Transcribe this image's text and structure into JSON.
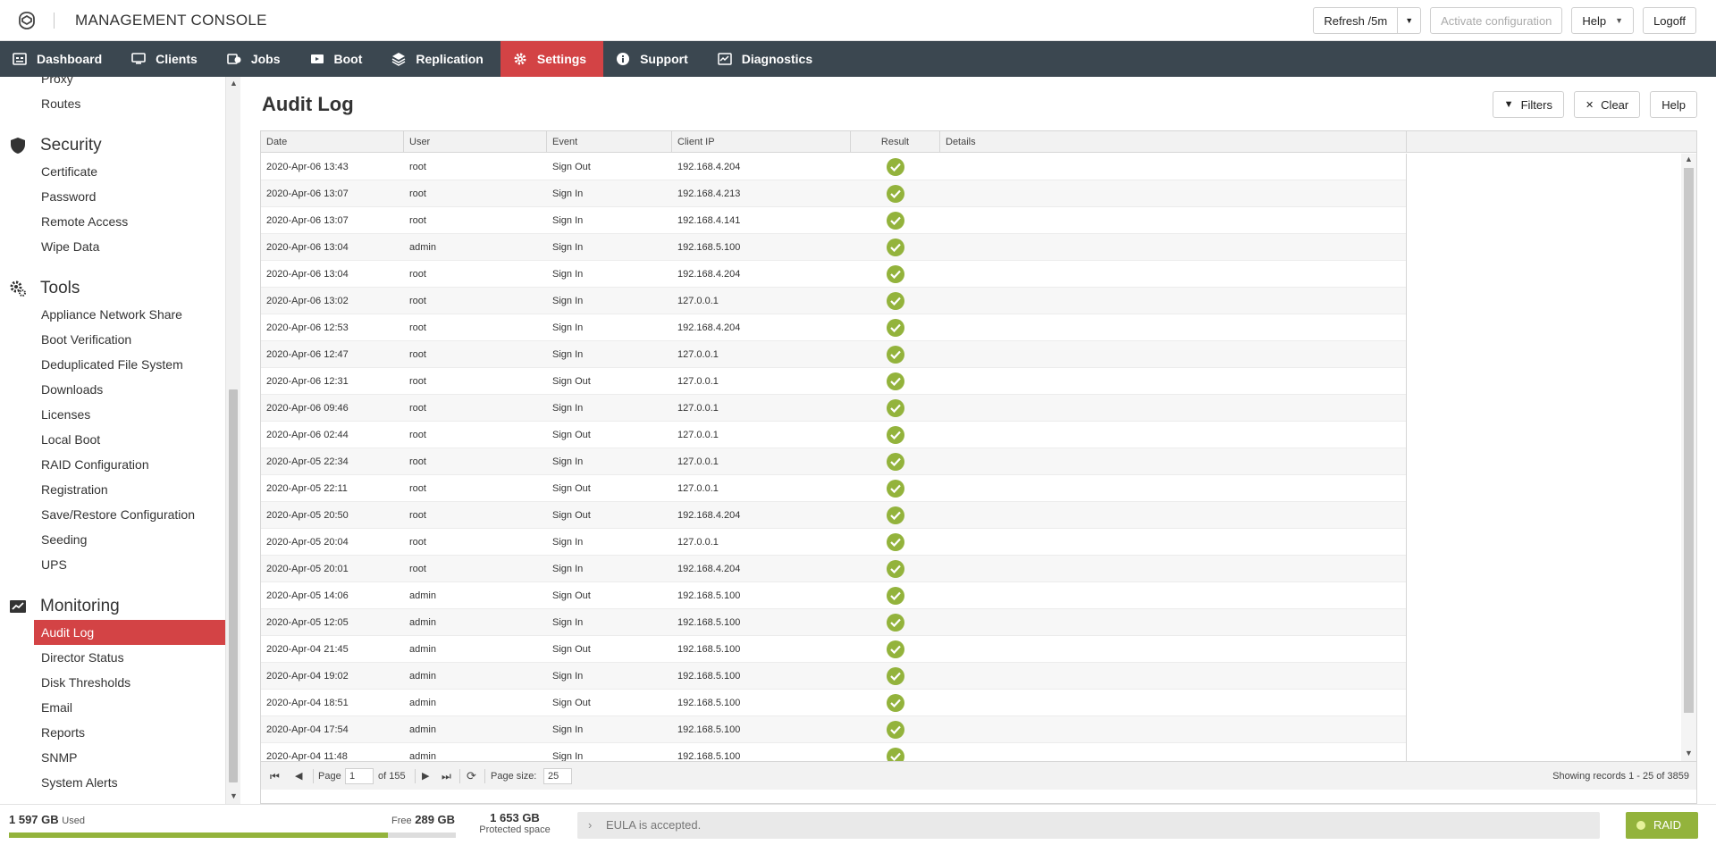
{
  "header": {
    "title": "MANAGEMENT CONSOLE",
    "refresh_label": "Refresh /5m",
    "activate_label": "Activate configuration",
    "help_label": "Help",
    "logoff_label": "Logoff"
  },
  "nav": [
    {
      "label": "Dashboard",
      "icon": "dashboard-icon"
    },
    {
      "label": "Clients",
      "icon": "monitor-icon"
    },
    {
      "label": "Jobs",
      "icon": "jobs-icon"
    },
    {
      "label": "Boot",
      "icon": "boot-icon"
    },
    {
      "label": "Replication",
      "icon": "replication-icon"
    },
    {
      "label": "Settings",
      "icon": "gear-icon",
      "active": true
    },
    {
      "label": "Support",
      "icon": "info-icon"
    },
    {
      "label": "Diagnostics",
      "icon": "diagnostics-icon"
    }
  ],
  "sidebar": {
    "network_tail": [
      "Proxy",
      "Routes"
    ],
    "security": {
      "title": "Security",
      "items": [
        "Certificate",
        "Password",
        "Remote Access",
        "Wipe Data"
      ]
    },
    "tools": {
      "title": "Tools",
      "items": [
        "Appliance Network Share",
        "Boot Verification",
        "Deduplicated File System",
        "Downloads",
        "Licenses",
        "Local Boot",
        "RAID Configuration",
        "Registration",
        "Save/Restore Configuration",
        "Seeding",
        "UPS"
      ]
    },
    "monitoring": {
      "title": "Monitoring",
      "items": [
        "Audit Log",
        "Director Status",
        "Disk Thresholds",
        "Email",
        "Reports",
        "SNMP",
        "System Alerts"
      ],
      "active": "Audit Log"
    }
  },
  "main": {
    "title": "Audit Log",
    "filters_label": "Filters",
    "clear_label": "Clear",
    "help_label": "Help"
  },
  "grid": {
    "columns": [
      "Date",
      "User",
      "Event",
      "Client IP",
      "Result",
      "Details"
    ],
    "rows": [
      [
        "2020-Apr-06 13:43",
        "root",
        "Sign Out",
        "192.168.4.204"
      ],
      [
        "2020-Apr-06 13:07",
        "root",
        "Sign In",
        "192.168.4.213"
      ],
      [
        "2020-Apr-06 13:07",
        "root",
        "Sign In",
        "192.168.4.141"
      ],
      [
        "2020-Apr-06 13:04",
        "admin",
        "Sign In",
        "192.168.5.100"
      ],
      [
        "2020-Apr-06 13:04",
        "root",
        "Sign In",
        "192.168.4.204"
      ],
      [
        "2020-Apr-06 13:02",
        "root",
        "Sign In",
        "127.0.0.1"
      ],
      [
        "2020-Apr-06 12:53",
        "root",
        "Sign In",
        "192.168.4.204"
      ],
      [
        "2020-Apr-06 12:47",
        "root",
        "Sign In",
        "127.0.0.1"
      ],
      [
        "2020-Apr-06 12:31",
        "root",
        "Sign Out",
        "127.0.0.1"
      ],
      [
        "2020-Apr-06 09:46",
        "root",
        "Sign In",
        "127.0.0.1"
      ],
      [
        "2020-Apr-06 02:44",
        "root",
        "Sign Out",
        "127.0.0.1"
      ],
      [
        "2020-Apr-05 22:34",
        "root",
        "Sign In",
        "127.0.0.1"
      ],
      [
        "2020-Apr-05 22:11",
        "root",
        "Sign Out",
        "127.0.0.1"
      ],
      [
        "2020-Apr-05 20:50",
        "root",
        "Sign Out",
        "192.168.4.204"
      ],
      [
        "2020-Apr-05 20:04",
        "root",
        "Sign In",
        "127.0.0.1"
      ],
      [
        "2020-Apr-05 20:01",
        "root",
        "Sign In",
        "192.168.4.204"
      ],
      [
        "2020-Apr-05 14:06",
        "admin",
        "Sign Out",
        "192.168.5.100"
      ],
      [
        "2020-Apr-05 12:05",
        "admin",
        "Sign In",
        "192.168.5.100"
      ],
      [
        "2020-Apr-04 21:45",
        "admin",
        "Sign Out",
        "192.168.5.100"
      ],
      [
        "2020-Apr-04 19:02",
        "admin",
        "Sign In",
        "192.168.5.100"
      ],
      [
        "2020-Apr-04 18:51",
        "admin",
        "Sign Out",
        "192.168.5.100"
      ],
      [
        "2020-Apr-04 17:54",
        "admin",
        "Sign In",
        "192.168.5.100"
      ],
      [
        "2020-Apr-04 11:48",
        "admin",
        "Sign In",
        "192.168.5.100"
      ]
    ],
    "result_icon": "check-circle-icon",
    "result_color": "#93b33c"
  },
  "pager": {
    "page_label": "Page",
    "page_value": "1",
    "of_label": "of 155",
    "page_size_label": "Page size:",
    "page_size_value": "25",
    "records_label": "Showing records 1 - 25 of 3859"
  },
  "footer": {
    "used_value": "1 597 GB",
    "used_label": "Used",
    "free_label": "Free",
    "free_value": "289 GB",
    "used_fraction": 0.847,
    "protected_value": "1 653 GB",
    "protected_label": "Protected space",
    "eula_text": "EULA is accepted.",
    "raid_label": "RAID"
  },
  "colors": {
    "navbar": "#3b4750",
    "accent": "#d34345",
    "ok": "#93b33c"
  }
}
